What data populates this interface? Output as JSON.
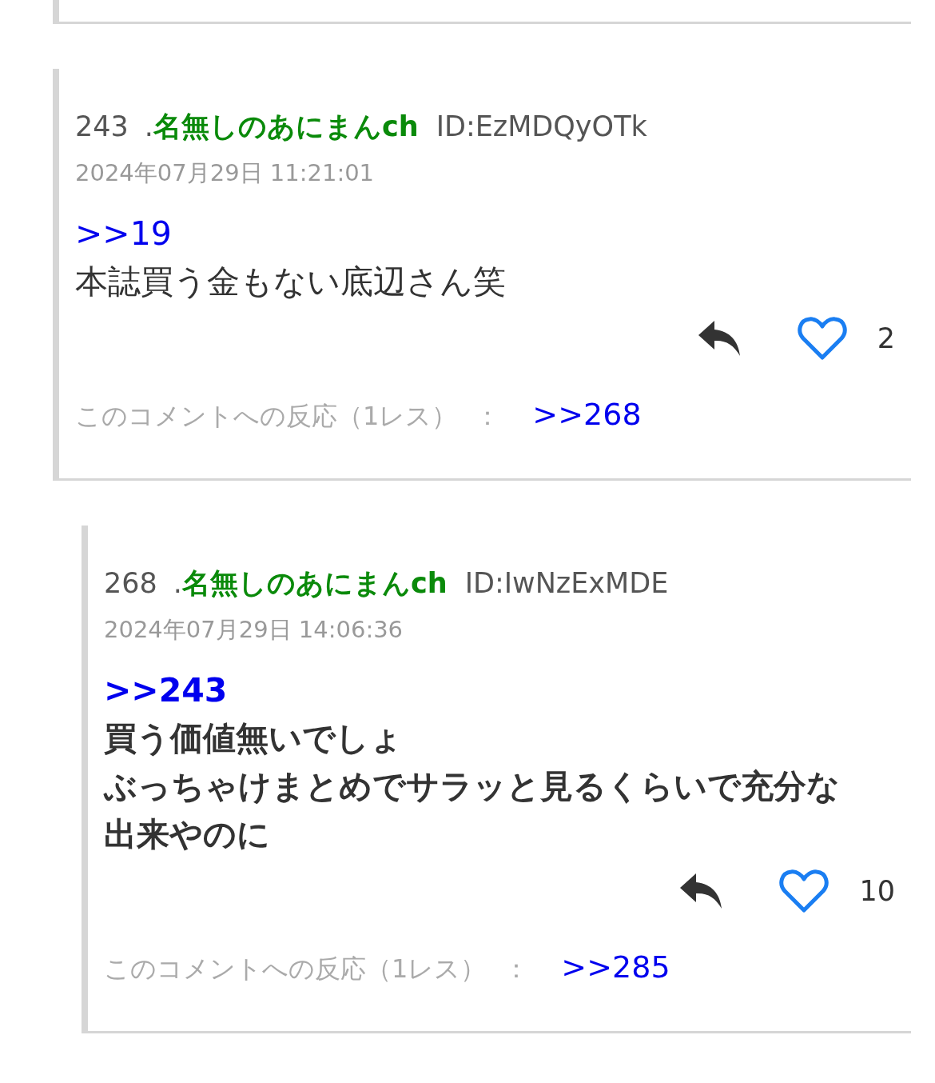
{
  "comments": [
    {
      "number": "243",
      "dot": ".",
      "name": "名無しのあにまんch",
      "id": "ID:EzMDQyOTk",
      "date": "2024年07月29日 11:21:01",
      "anchor": ">>19",
      "bold": false,
      "lines": [
        "本誌買う金もない底辺さん笑"
      ],
      "liked": false,
      "likes": "2",
      "reactions": {
        "label": "このコメントへの反応（1レス）",
        "separator": "：",
        "links": [
          ">>268"
        ]
      },
      "children": [
        {
          "number": "268",
          "dot": ".",
          "name": "名無しのあにまんch",
          "id": "ID:IwNzExMDE",
          "date": "2024年07月29日 14:06:36",
          "anchor": ">>243",
          "bold": true,
          "lines": [
            "買う価値無いでしょ",
            "ぶっちゃけまとめでサラッと見るくらいで充分な出来やのに"
          ],
          "liked": false,
          "likes": "10",
          "reactions": {
            "label": "このコメントへの反応（1レス）",
            "separator": "：",
            "links": [
              ">>285"
            ]
          }
        }
      ]
    }
  ]
}
